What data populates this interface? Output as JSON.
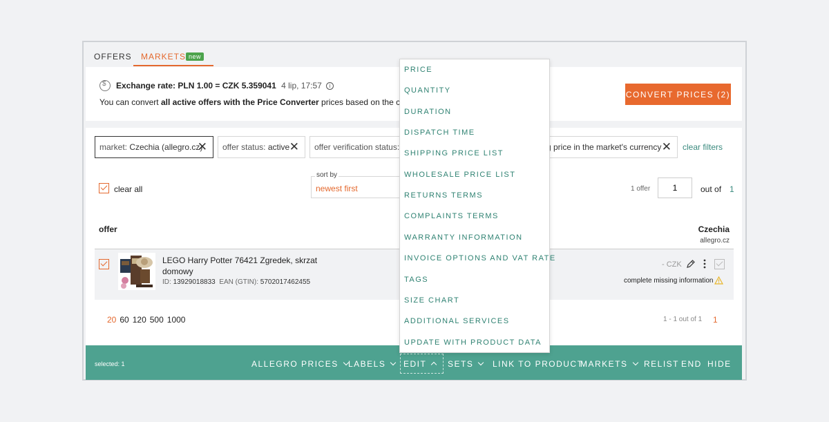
{
  "tabs": {
    "offers": "OFFERS",
    "markets": "MARKETS",
    "new_badge": "new"
  },
  "exchange": {
    "label": "Exchange rate: PLN 1.00 = CZK 5.359041",
    "date": "4 lip, 17:57",
    "desc_prefix": "You can convert ",
    "desc_bold": "all active offers with the Price Converter",
    "desc_suffix": " prices based on the current",
    "convert_button": "CONVERT PRICES (2)"
  },
  "filters": {
    "market_key": "market: ",
    "market_value": "Czechia (allegro.cz)",
    "status_key": "offer status: ",
    "status_value": "active",
    "verification_key": "offer verification status: r",
    "price_text": "g price in the market's currency",
    "clear_filters": "clear filters"
  },
  "list": {
    "clear_all": "clear all",
    "sort_label": "sort by",
    "sort_value": "newest first",
    "offer_count": "1 offer",
    "page_value": "1",
    "out_of": "out of",
    "total_pages": "1",
    "col_offer": "offer",
    "col_market": "Czechia",
    "col_market_sub": "allegro.cz"
  },
  "offer": {
    "title": "LEGO Harry Potter 76421 Zgredek, skrzat domowy",
    "id_label": "ID: ",
    "id_value": "13929018833",
    "ean_label": "EAN (GTIN): ",
    "ean_value": "5702017462455",
    "price": "- CZK",
    "missing_info": "complete missing information"
  },
  "pagination": {
    "sizes": [
      "20",
      "60",
      "120",
      "500",
      "1000"
    ],
    "range": "1 - 1 out of 1",
    "current": "1"
  },
  "action_bar": {
    "selected": "selected: 1",
    "allegro_prices": "ALLEGRO PRICES",
    "labels": "LABELS",
    "edit": "EDIT",
    "sets": "SETS",
    "link_to_product": "LINK TO PRODUCT",
    "markets": "MARKETS",
    "relist": "RELIST",
    "end": "END",
    "hide": "HIDE"
  },
  "edit_menu": [
    "PRICE",
    "QUANTITY",
    "DURATION",
    "DISPATCH TIME",
    "SHIPPING PRICE LIST",
    "WHOLESALE PRICE LIST",
    "RETURNS TERMS",
    "COMPLAINTS TERMS",
    "WARRANTY INFORMATION",
    "INVOICE OPTIONS AND VAT RATE",
    "TAGS",
    "SIZE CHART",
    "ADDITIONAL SERVICES",
    "UPDATE WITH PRODUCT DATA"
  ],
  "colors": {
    "accent": "#e8692e",
    "teal": "#4ea290",
    "link": "#3a8a7e"
  }
}
